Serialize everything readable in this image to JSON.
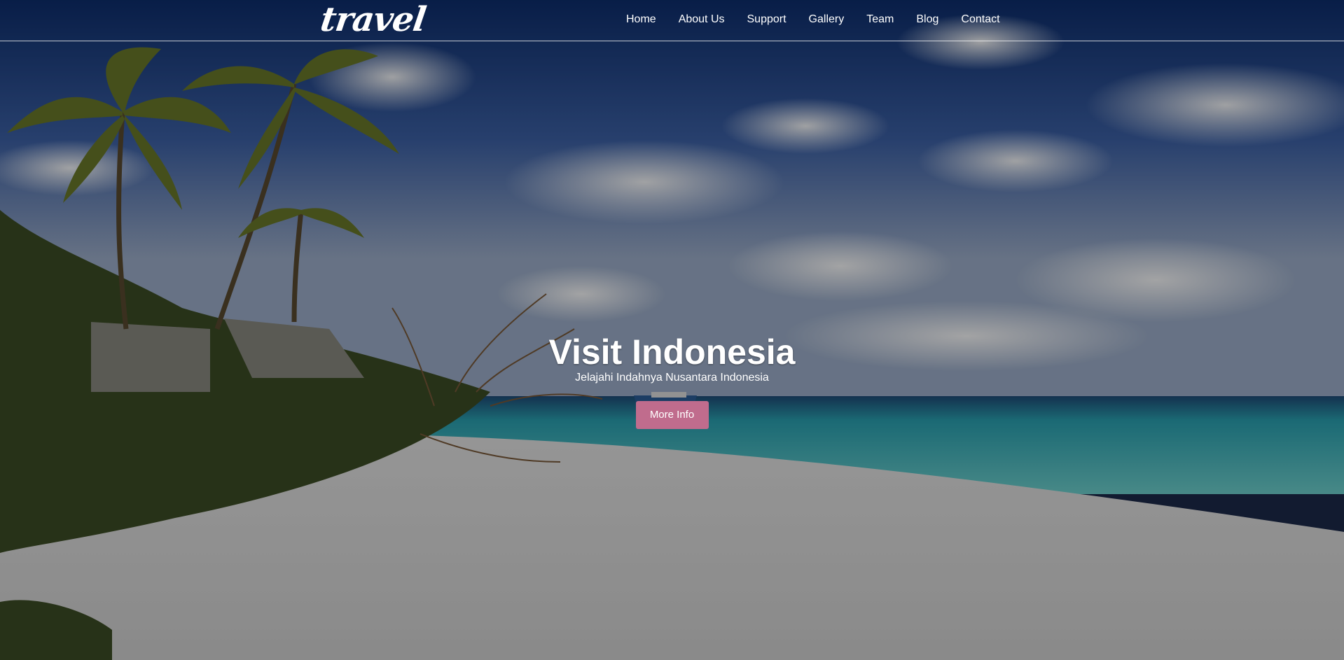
{
  "brand": {
    "logo_text": "travel"
  },
  "nav": {
    "items": [
      {
        "label": "Home"
      },
      {
        "label": "About Us"
      },
      {
        "label": "Support"
      },
      {
        "label": "Gallery"
      },
      {
        "label": "Team"
      },
      {
        "label": "Blog"
      },
      {
        "label": "Contact"
      }
    ]
  },
  "hero": {
    "title": "Visit Indonesia",
    "subtitle": "Jelajahi Indahnya Nusantara Indonesia",
    "button_label": "More Info"
  },
  "colors": {
    "accent_button": "#c06c8d",
    "nav_text": "#ffffff"
  },
  "icons": {
    "background": "tropical-beach-photo"
  }
}
